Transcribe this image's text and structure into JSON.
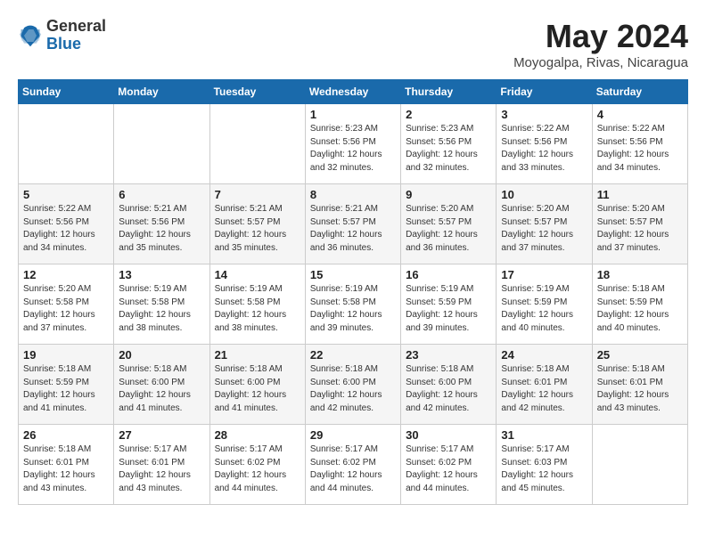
{
  "logo": {
    "general": "General",
    "blue": "Blue"
  },
  "header": {
    "month": "May 2024",
    "location": "Moyogalpa, Rivas, Nicaragua"
  },
  "days_of_week": [
    "Sunday",
    "Monday",
    "Tuesday",
    "Wednesday",
    "Thursday",
    "Friday",
    "Saturday"
  ],
  "weeks": [
    [
      {
        "day": "",
        "info": ""
      },
      {
        "day": "",
        "info": ""
      },
      {
        "day": "",
        "info": ""
      },
      {
        "day": "1",
        "info": "Sunrise: 5:23 AM\nSunset: 5:56 PM\nDaylight: 12 hours\nand 32 minutes."
      },
      {
        "day": "2",
        "info": "Sunrise: 5:23 AM\nSunset: 5:56 PM\nDaylight: 12 hours\nand 32 minutes."
      },
      {
        "day": "3",
        "info": "Sunrise: 5:22 AM\nSunset: 5:56 PM\nDaylight: 12 hours\nand 33 minutes."
      },
      {
        "day": "4",
        "info": "Sunrise: 5:22 AM\nSunset: 5:56 PM\nDaylight: 12 hours\nand 34 minutes."
      }
    ],
    [
      {
        "day": "5",
        "info": "Sunrise: 5:22 AM\nSunset: 5:56 PM\nDaylight: 12 hours\nand 34 minutes."
      },
      {
        "day": "6",
        "info": "Sunrise: 5:21 AM\nSunset: 5:56 PM\nDaylight: 12 hours\nand 35 minutes."
      },
      {
        "day": "7",
        "info": "Sunrise: 5:21 AM\nSunset: 5:57 PM\nDaylight: 12 hours\nand 35 minutes."
      },
      {
        "day": "8",
        "info": "Sunrise: 5:21 AM\nSunset: 5:57 PM\nDaylight: 12 hours\nand 36 minutes."
      },
      {
        "day": "9",
        "info": "Sunrise: 5:20 AM\nSunset: 5:57 PM\nDaylight: 12 hours\nand 36 minutes."
      },
      {
        "day": "10",
        "info": "Sunrise: 5:20 AM\nSunset: 5:57 PM\nDaylight: 12 hours\nand 37 minutes."
      },
      {
        "day": "11",
        "info": "Sunrise: 5:20 AM\nSunset: 5:57 PM\nDaylight: 12 hours\nand 37 minutes."
      }
    ],
    [
      {
        "day": "12",
        "info": "Sunrise: 5:20 AM\nSunset: 5:58 PM\nDaylight: 12 hours\nand 37 minutes."
      },
      {
        "day": "13",
        "info": "Sunrise: 5:19 AM\nSunset: 5:58 PM\nDaylight: 12 hours\nand 38 minutes."
      },
      {
        "day": "14",
        "info": "Sunrise: 5:19 AM\nSunset: 5:58 PM\nDaylight: 12 hours\nand 38 minutes."
      },
      {
        "day": "15",
        "info": "Sunrise: 5:19 AM\nSunset: 5:58 PM\nDaylight: 12 hours\nand 39 minutes."
      },
      {
        "day": "16",
        "info": "Sunrise: 5:19 AM\nSunset: 5:59 PM\nDaylight: 12 hours\nand 39 minutes."
      },
      {
        "day": "17",
        "info": "Sunrise: 5:19 AM\nSunset: 5:59 PM\nDaylight: 12 hours\nand 40 minutes."
      },
      {
        "day": "18",
        "info": "Sunrise: 5:18 AM\nSunset: 5:59 PM\nDaylight: 12 hours\nand 40 minutes."
      }
    ],
    [
      {
        "day": "19",
        "info": "Sunrise: 5:18 AM\nSunset: 5:59 PM\nDaylight: 12 hours\nand 41 minutes."
      },
      {
        "day": "20",
        "info": "Sunrise: 5:18 AM\nSunset: 6:00 PM\nDaylight: 12 hours\nand 41 minutes."
      },
      {
        "day": "21",
        "info": "Sunrise: 5:18 AM\nSunset: 6:00 PM\nDaylight: 12 hours\nand 41 minutes."
      },
      {
        "day": "22",
        "info": "Sunrise: 5:18 AM\nSunset: 6:00 PM\nDaylight: 12 hours\nand 42 minutes."
      },
      {
        "day": "23",
        "info": "Sunrise: 5:18 AM\nSunset: 6:00 PM\nDaylight: 12 hours\nand 42 minutes."
      },
      {
        "day": "24",
        "info": "Sunrise: 5:18 AM\nSunset: 6:01 PM\nDaylight: 12 hours\nand 42 minutes."
      },
      {
        "day": "25",
        "info": "Sunrise: 5:18 AM\nSunset: 6:01 PM\nDaylight: 12 hours\nand 43 minutes."
      }
    ],
    [
      {
        "day": "26",
        "info": "Sunrise: 5:18 AM\nSunset: 6:01 PM\nDaylight: 12 hours\nand 43 minutes."
      },
      {
        "day": "27",
        "info": "Sunrise: 5:17 AM\nSunset: 6:01 PM\nDaylight: 12 hours\nand 43 minutes."
      },
      {
        "day": "28",
        "info": "Sunrise: 5:17 AM\nSunset: 6:02 PM\nDaylight: 12 hours\nand 44 minutes."
      },
      {
        "day": "29",
        "info": "Sunrise: 5:17 AM\nSunset: 6:02 PM\nDaylight: 12 hours\nand 44 minutes."
      },
      {
        "day": "30",
        "info": "Sunrise: 5:17 AM\nSunset: 6:02 PM\nDaylight: 12 hours\nand 44 minutes."
      },
      {
        "day": "31",
        "info": "Sunrise: 5:17 AM\nSunset: 6:03 PM\nDaylight: 12 hours\nand 45 minutes."
      },
      {
        "day": "",
        "info": ""
      }
    ]
  ]
}
